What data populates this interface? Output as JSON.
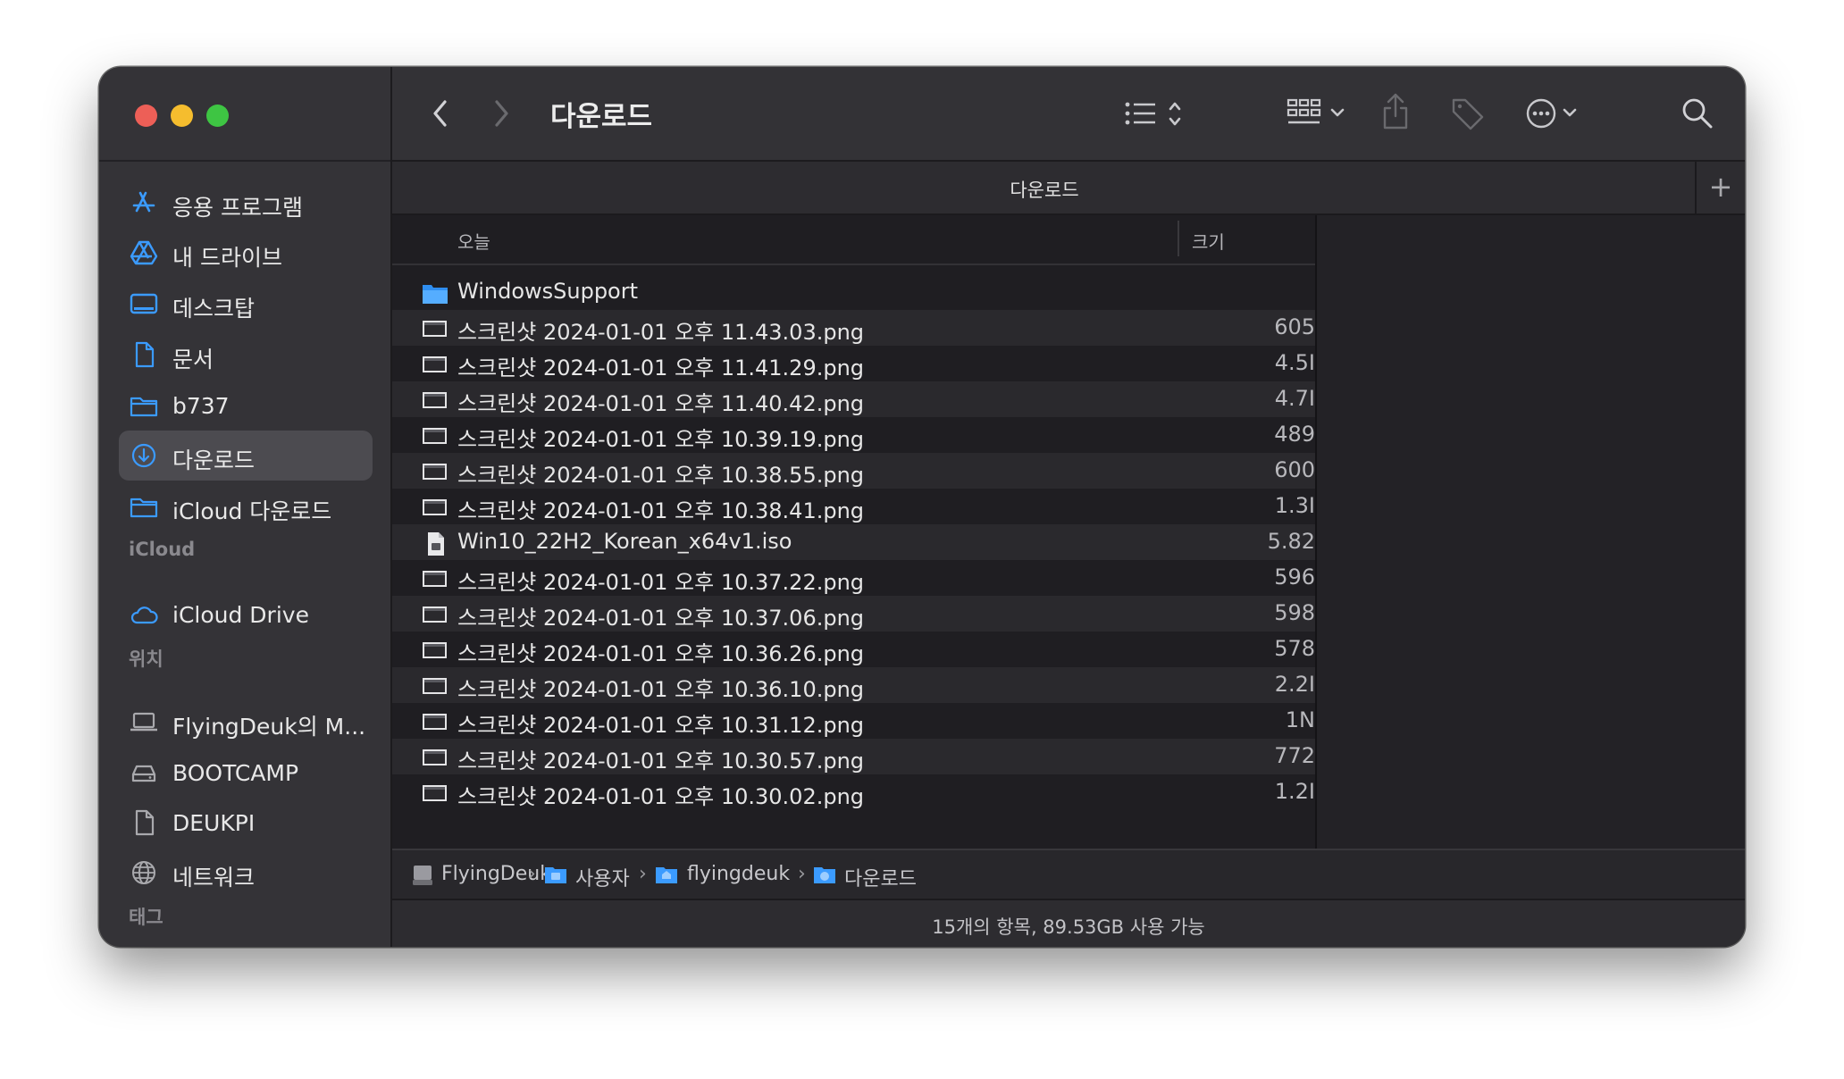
{
  "window": {
    "title": "다운로드",
    "tab_title": "다운로드",
    "tab_add": "+"
  },
  "sidebar": {
    "favorites": [
      {
        "label": "응용 프로그램",
        "icon": "applications-icon"
      },
      {
        "label": "내 드라이브",
        "icon": "google-drive-icon"
      },
      {
        "label": "데스크탑",
        "icon": "desktop-icon"
      },
      {
        "label": "문서",
        "icon": "document-icon"
      },
      {
        "label": "b737",
        "icon": "folder-icon"
      },
      {
        "label": "다운로드",
        "icon": "downloads-icon",
        "selected": true
      },
      {
        "label": "iCloud 다운로드",
        "icon": "folder-icon"
      }
    ],
    "icloud_header": "iCloud",
    "icloud": [
      {
        "label": "iCloud Drive",
        "icon": "cloud-icon"
      }
    ],
    "locations_header": "위치",
    "locations": [
      {
        "label": "FlyingDeuk의 M...",
        "icon": "laptop-icon"
      },
      {
        "label": "BOOTCAMP",
        "icon": "disk-icon"
      },
      {
        "label": "DEUKPI",
        "icon": "file-icon"
      },
      {
        "label": "네트워크",
        "icon": "network-icon"
      }
    ],
    "tags_header": "태그"
  },
  "columns": {
    "today": "오늘",
    "size": "크기"
  },
  "files": [
    {
      "name": "WindowsSupport",
      "size": "",
      "icon": "folder-icon"
    },
    {
      "name": "스크린샷 2024-01-01 오후 11.43.03.png",
      "size": "605",
      "icon": "image-file-icon"
    },
    {
      "name": "스크린샷 2024-01-01 오후 11.41.29.png",
      "size": "4.5I",
      "icon": "image-file-icon"
    },
    {
      "name": "스크린샷 2024-01-01 오후 11.40.42.png",
      "size": "4.7I",
      "icon": "image-file-icon"
    },
    {
      "name": "스크린샷 2024-01-01 오후 10.39.19.png",
      "size": "489",
      "icon": "image-file-icon"
    },
    {
      "name": "스크린샷 2024-01-01 오후 10.38.55.png",
      "size": "600",
      "icon": "image-file-icon"
    },
    {
      "name": "스크린샷 2024-01-01 오후 10.38.41.png",
      "size": "1.3I",
      "icon": "image-file-icon"
    },
    {
      "name": "Win10_22H2_Korean_x64v1.iso",
      "size": "5.82",
      "icon": "disk-image-file-icon"
    },
    {
      "name": "스크린샷 2024-01-01 오후 10.37.22.png",
      "size": "596",
      "icon": "image-file-icon"
    },
    {
      "name": "스크린샷 2024-01-01 오후 10.37.06.png",
      "size": "598",
      "icon": "image-file-icon"
    },
    {
      "name": "스크린샷 2024-01-01 오후 10.36.26.png",
      "size": "578",
      "icon": "image-file-icon"
    },
    {
      "name": "스크린샷 2024-01-01 오후 10.36.10.png",
      "size": "2.2I",
      "icon": "image-file-icon"
    },
    {
      "name": "스크린샷 2024-01-01 오후 10.31.12.png",
      "size": "1N",
      "icon": "image-file-icon"
    },
    {
      "name": "스크린샷 2024-01-01 오후 10.30.57.png",
      "size": "772",
      "icon": "image-file-icon"
    },
    {
      "name": "스크린샷 2024-01-01 오후 10.30.02.png",
      "size": "1.2I",
      "icon": "image-file-icon"
    }
  ],
  "path": [
    "FlyingDeuk",
    "사용자",
    "flyingdeuk",
    "다운로드"
  ],
  "path_separator": "›",
  "status": "15개의 항목, 89.53GB 사용 가능",
  "colors": {
    "accent": "#3b9bff",
    "selected_row": "#4c4b50",
    "traffic_red": "#ed5f57",
    "traffic_yellow": "#f5bd2e",
    "traffic_green": "#3ec543"
  }
}
